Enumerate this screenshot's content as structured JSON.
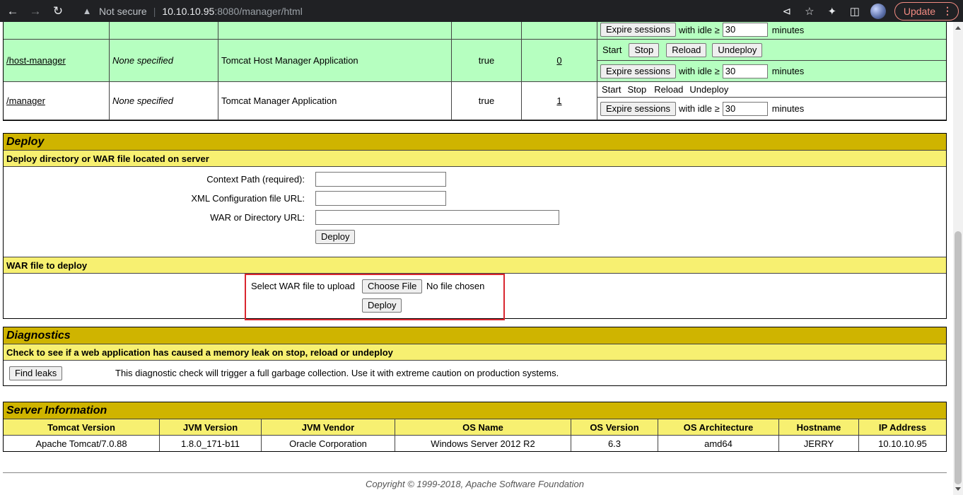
{
  "browser": {
    "not_secure": "Not secure",
    "url_host": "10.10.10.95",
    "url_rest": ":8080/manager/html",
    "update_label": "Update"
  },
  "applications": {
    "expire_label": "Expire sessions",
    "idle_label": "with idle ≥",
    "minutes_label": "minutes",
    "rows": [
      {
        "path": "",
        "version": "",
        "display_name": "",
        "running": "",
        "sessions": "",
        "idle": "30"
      },
      {
        "path": "/host-manager",
        "version": "None specified",
        "display_name": "Tomcat Host Manager Application",
        "running": "true",
        "sessions": "0",
        "idle": "30",
        "commands": [
          "Start",
          "Stop",
          "Reload",
          "Undeploy"
        ]
      },
      {
        "path": "/manager",
        "version": "None specified",
        "display_name": "Tomcat Manager Application",
        "running": "true",
        "sessions": "1",
        "idle": "30",
        "commands": [
          "Start",
          "Stop",
          "Reload",
          "Undeploy"
        ]
      }
    ]
  },
  "deploy": {
    "title": "Deploy",
    "server_subtitle": "Deploy directory or WAR file located on server",
    "context_path_label": "Context Path (required):",
    "xml_config_label": "XML Configuration file URL:",
    "war_dir_label": "WAR or Directory URL:",
    "deploy_button": "Deploy",
    "war_subtitle": "WAR file to deploy",
    "select_war_label": "Select WAR file to upload",
    "choose_file_button": "Choose File",
    "no_file_text": "No file chosen",
    "war_deploy_button": "Deploy"
  },
  "diagnostics": {
    "title": "Diagnostics",
    "subtitle": "Check to see if a web application has caused a memory leak on stop, reload or undeploy",
    "find_leaks_button": "Find leaks",
    "description": "This diagnostic check will trigger a full garbage collection. Use it with extreme caution on production systems."
  },
  "server_info": {
    "title": "Server Information",
    "headers": [
      "Tomcat Version",
      "JVM Version",
      "JVM Vendor",
      "OS Name",
      "OS Version",
      "OS Architecture",
      "Hostname",
      "IP Address"
    ],
    "values": [
      "Apache Tomcat/7.0.88",
      "1.8.0_171-b11",
      "Oracle Corporation",
      "Windows Server 2012 R2",
      "6.3",
      "amd64",
      "JERRY",
      "10.10.10.95"
    ]
  },
  "footer": {
    "copyright": "Copyright © 1999-2018, Apache Software Foundation"
  }
}
